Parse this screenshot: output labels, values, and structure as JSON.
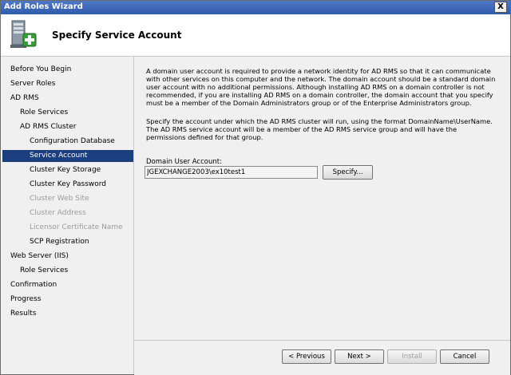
{
  "window": {
    "title": "Add Roles Wizard",
    "close_label": "X"
  },
  "header": {
    "title": "Specify Service Account",
    "icon": "server-roles-add-icon"
  },
  "sidebar": {
    "items": [
      {
        "label": "Before You Begin",
        "state": "normal"
      },
      {
        "label": "Server Roles",
        "state": "normal"
      },
      {
        "label": "AD RMS",
        "state": "normal"
      },
      {
        "label": "Role Services",
        "state": "normal"
      },
      {
        "label": "AD RMS Cluster",
        "state": "normal"
      },
      {
        "label": "Configuration Database",
        "state": "normal"
      },
      {
        "label": "Service Account",
        "state": "selected"
      },
      {
        "label": "Cluster Key Storage",
        "state": "normal"
      },
      {
        "label": "Cluster Key Password",
        "state": "normal"
      },
      {
        "label": "Cluster Web Site",
        "state": "disabled"
      },
      {
        "label": "Cluster Address",
        "state": "disabled"
      },
      {
        "label": "Licensor Certificate Name",
        "state": "disabled"
      },
      {
        "label": "SCP Registration",
        "state": "normal"
      },
      {
        "label": "Web Server (IIS)",
        "state": "normal"
      },
      {
        "label": "Role Services",
        "state": "normal"
      },
      {
        "label": "Confirmation",
        "state": "normal"
      },
      {
        "label": "Progress",
        "state": "normal"
      },
      {
        "label": "Results",
        "state": "normal"
      }
    ]
  },
  "content": {
    "paragraph1": "A domain user account is required to provide a network identity for AD RMS so that it can communicate with other services on this computer and the network. The domain account should be a standard domain user account with no additional permissions. Although installing AD RMS on a domain controller is not recommended, if you are installing AD RMS on a domain controller, the domain account that you specify must be a member of the Domain Administrators group or of the Enterprise Administrators group.",
    "paragraph2": "Specify the account under which the AD RMS cluster will run, using the format DomainName\\UserName. The AD RMS service account will be a member of the AD RMS service group and will have the permissions defined for that group.",
    "account_label": "Domain User Account:",
    "account_value": "JGEXCHANGE2003\\ex10test1",
    "specify_button": "Specify..."
  },
  "footer": {
    "previous": "< Previous",
    "next": "Next >",
    "install": "Install",
    "cancel": "Cancel"
  }
}
